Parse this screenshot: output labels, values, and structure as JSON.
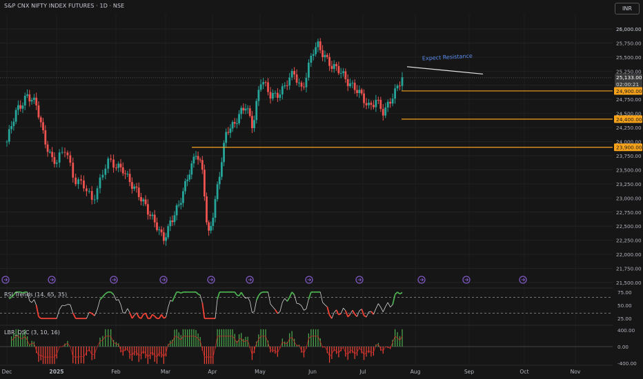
{
  "header": {
    "symbol_title": "S&P CNX NIFTY INDEX FUTURES · 1D · NSE",
    "currency": "INR"
  },
  "colors": {
    "background": "#161616",
    "up": "#26a69a",
    "down": "#ef5350",
    "level": "#f7a21b",
    "rsi_line": "#d8d8d8",
    "rsi_hot": "#4caf50",
    "rsi_cold": "#f44336",
    "osc_up": "#4caf50",
    "osc_down": "#f44336",
    "event_icon": "#7e57c2"
  },
  "price_axis": {
    "ticks": [
      "25,000.00",
      "25,750.00",
      "25,500.00",
      "25,250.00",
      "24,750.00",
      "24,500.00",
      "24,250.00",
      "24,000.00",
      "23,750.00",
      "23,500.00",
      "23,250.00",
      "23,000.00",
      "22,750.00",
      "22,500.00",
      "22,250.00",
      "22,000.00",
      "21,750.00",
      "21,500.00"
    ],
    "tick_values": [
      26000,
      25750,
      25500,
      25250,
      24750,
      24500,
      24250,
      24000,
      23750,
      23500,
      23250,
      23000,
      22750,
      22500,
      22250,
      22000,
      21750,
      21500
    ],
    "top_tick_label": "26,000.00",
    "price_tag": {
      "value": 25133,
      "label": "25,133.00",
      "countdown": "02:00:21"
    },
    "level_tags": [
      {
        "value": 24900,
        "label": "24,900.00"
      },
      {
        "value": 24400,
        "label": "24,400.00"
      },
      {
        "value": 23900,
        "label": "23,900.00"
      }
    ]
  },
  "time_axis": [
    "Dec",
    "2025",
    "Feb",
    "Mar",
    "Apr",
    "May",
    "Jun",
    "Jul",
    "Aug",
    "Sep",
    "Oct",
    "Nov"
  ],
  "annotation": {
    "text": "Expect Resistance",
    "from_price": 25330,
    "to_price": 25200
  },
  "rsi_pane": {
    "title": "RSI Trends (14, 65, 35)",
    "ticks": [
      "75.00",
      "50.00",
      "25.00"
    ],
    "tick_values": [
      75,
      50,
      25
    ],
    "upper": 65,
    "lower": 35
  },
  "osc_pane": {
    "title": "LBR_OSC (3, 10, 16)",
    "ticks": [
      "400.00",
      "0.00",
      "-400.00"
    ],
    "tick_values": [
      400,
      0,
      -400
    ]
  },
  "chart_data": {
    "type": "candlestick",
    "title": "S&P CNX NIFTY INDEX FUTURES · 1D · NSE",
    "ylim": [
      21500,
      26000
    ],
    "x_months": [
      "Dec",
      "2025",
      "Feb",
      "Mar",
      "Apr",
      "May",
      "Jun",
      "Jul",
      "Aug",
      "Sep",
      "Oct",
      "Nov"
    ],
    "close_path": [
      {
        "m": 0.0,
        "v": 24000
      },
      {
        "m": 0.2,
        "v": 24550
      },
      {
        "m": 0.4,
        "v": 24850
      },
      {
        "m": 0.6,
        "v": 24600
      },
      {
        "m": 0.75,
        "v": 24100
      },
      {
        "m": 0.9,
        "v": 23700
      },
      {
        "m": 1.0,
        "v": 23600
      },
      {
        "m": 1.15,
        "v": 23900
      },
      {
        "m": 1.3,
        "v": 23350
      },
      {
        "m": 1.45,
        "v": 23200
      },
      {
        "m": 1.6,
        "v": 22950
      },
      {
        "m": 1.7,
        "v": 23250
      },
      {
        "m": 1.85,
        "v": 23650
      },
      {
        "m": 1.95,
        "v": 23550
      },
      {
        "m": 2.15,
        "v": 23550
      },
      {
        "m": 2.35,
        "v": 23150
      },
      {
        "m": 2.6,
        "v": 22900
      },
      {
        "m": 2.8,
        "v": 22500
      },
      {
        "m": 2.95,
        "v": 22250
      },
      {
        "m": 3.1,
        "v": 22600
      },
      {
        "m": 3.3,
        "v": 22850
      },
      {
        "m": 3.5,
        "v": 23500
      },
      {
        "m": 3.65,
        "v": 23800
      },
      {
        "m": 3.8,
        "v": 23400
      },
      {
        "m": 3.9,
        "v": 22300
      },
      {
        "m": 4.0,
        "v": 22700
      },
      {
        "m": 4.15,
        "v": 23400
      },
      {
        "m": 4.3,
        "v": 24200
      },
      {
        "m": 4.5,
        "v": 24400
      },
      {
        "m": 4.7,
        "v": 24600
      },
      {
        "m": 4.85,
        "v": 24300
      },
      {
        "m": 5.0,
        "v": 25100
      },
      {
        "m": 5.2,
        "v": 24800
      },
      {
        "m": 5.45,
        "v": 24950
      },
      {
        "m": 5.65,
        "v": 25200
      },
      {
        "m": 5.8,
        "v": 24950
      },
      {
        "m": 6.0,
        "v": 25550
      },
      {
        "m": 6.1,
        "v": 25700
      },
      {
        "m": 6.25,
        "v": 25550
      },
      {
        "m": 6.4,
        "v": 25300
      },
      {
        "m": 6.6,
        "v": 25200
      },
      {
        "m": 6.75,
        "v": 25050
      },
      {
        "m": 6.95,
        "v": 24800
      },
      {
        "m": 7.1,
        "v": 24650
      },
      {
        "m": 7.25,
        "v": 24750
      },
      {
        "m": 7.4,
        "v": 24450
      },
      {
        "m": 7.5,
        "v": 24700
      },
      {
        "m": 7.65,
        "v": 25000
      },
      {
        "m": 7.75,
        "v": 25133
      }
    ],
    "levels": [
      24900,
      24400,
      23900
    ],
    "last_price": 25133,
    "rsi_ylim": [
      20,
      80
    ],
    "osc_ylim": [
      -450,
      450
    ]
  }
}
